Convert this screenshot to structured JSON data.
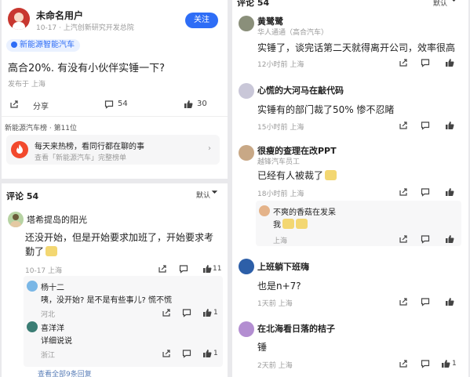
{
  "post": {
    "author": "未命名用户",
    "meta": "10-17 · 上汽创新研究开发总院",
    "follow_label": "关注",
    "tag": "新能源智能汽车",
    "content": "高合20%. 有没有小伙伴实锤一下?",
    "published": "发布于 上海",
    "share_label": "分享",
    "comment_count": "54",
    "like_count": "30",
    "ranking": "新能源汽车榜 · 第11位",
    "promo_title": "每天来热榜，看同行都在聊的事",
    "promo_sub": "查看「新能源汽车」完整榜单"
  },
  "left_comments": {
    "header": "评论 54",
    "sort_label": "默认",
    "items": [
      {
        "name": "塔希提岛的阳光",
        "text": "还没开始，但是开始要求加班了，开始要求考勤了",
        "meta": "10-17 上海",
        "likes": "11",
        "replies": [
          {
            "name": "杨十二",
            "text": "咦，没开始? 是不是有些事儿? 慌不慌",
            "meta": "河北",
            "likes": "1"
          },
          {
            "name": "喜洋洋",
            "text": "详细说说",
            "meta": "浙江",
            "likes": "1"
          }
        ],
        "more_replies": "查看全部9条回复"
      }
    ]
  },
  "right_comments": {
    "header": "评论 54",
    "sort_label": "默认",
    "items": [
      {
        "name": "黄鹭鹭",
        "badge": "华人通通（高合汽车）",
        "text": "实锤了，谈完话第二天就得离开公司，效率很高",
        "meta": "12小时前 上海"
      },
      {
        "name": "心慌的大河马在敲代码",
        "text": "实锤有的部门裁了50%   惨不忍睹",
        "meta": "15小时前 上海"
      },
      {
        "name": "很瘦的查理在改PPT",
        "badge": "越锋汽车员工",
        "text": "已经有人被裁了",
        "meta": "18小时前 上海",
        "replies": [
          {
            "name": "不爽的香菇在发呆",
            "text": "我",
            "meta": "上海"
          }
        ]
      },
      {
        "name": "上班躺下班嗨",
        "text": "也是n+7?",
        "meta": "1天前 上海"
      },
      {
        "name": "在北海看日落的桔子",
        "text": "锤",
        "meta": "2天前 上海",
        "likes": "1"
      }
    ]
  },
  "colors": {
    "accent": "#2e6df6",
    "promo_red": "#f2492d"
  }
}
